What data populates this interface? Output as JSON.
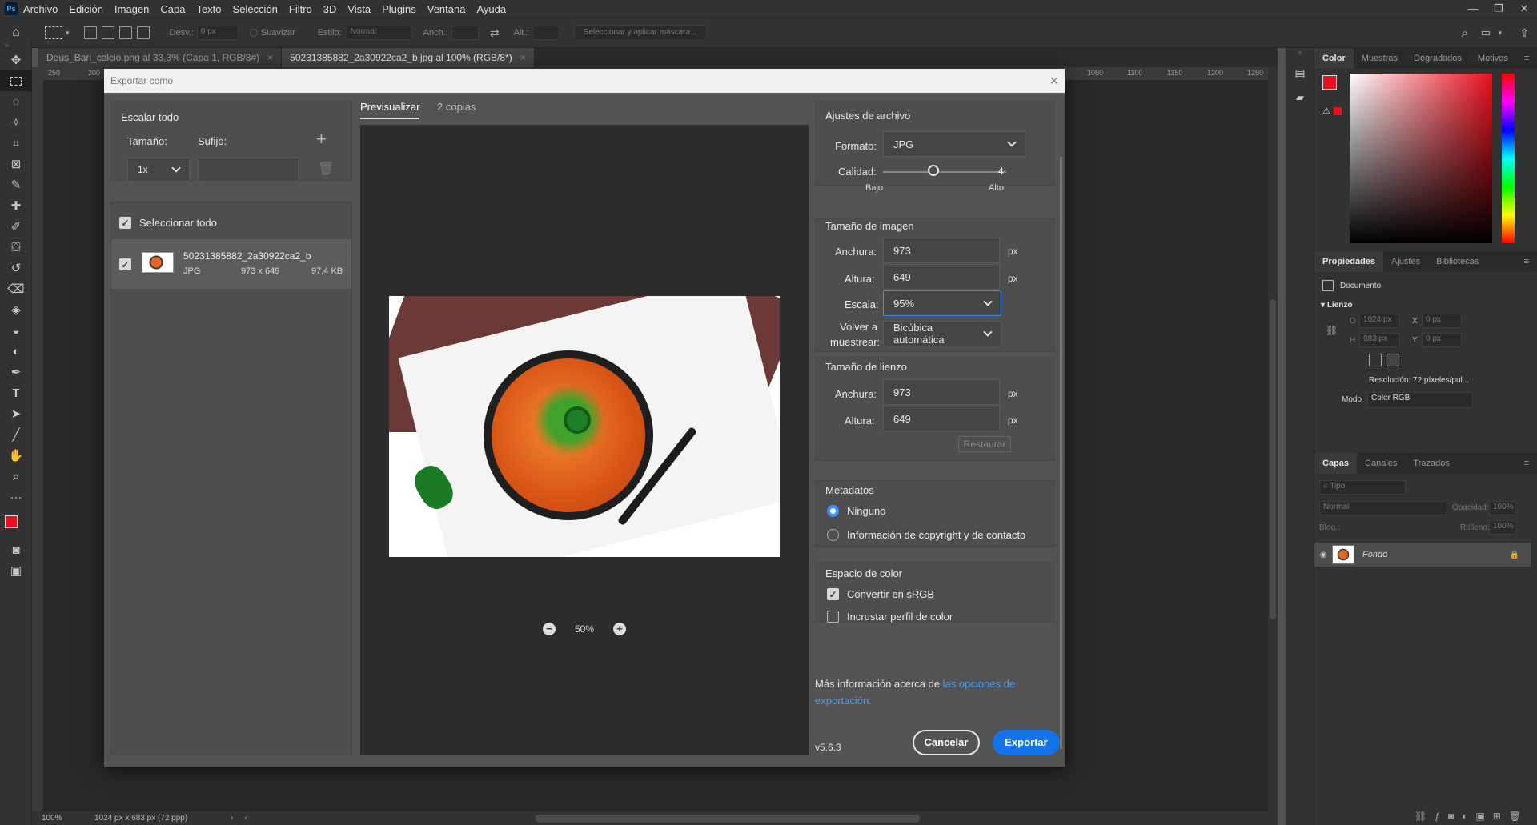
{
  "app": {
    "logo": "Ps",
    "menu": [
      "Archivo",
      "Edición",
      "Imagen",
      "Capa",
      "Texto",
      "Selección",
      "Filtro",
      "3D",
      "Vista",
      "Plugins",
      "Ventana",
      "Ayuda"
    ]
  },
  "options_bar": {
    "desv_label": "Desv.:",
    "desv_value": "0 px",
    "suavizar": "Suavizar",
    "estilo_label": "Estilo:",
    "estilo_value": "Normal",
    "anch_label": "Anch.:",
    "alt_label": "Alt.:",
    "mask_button": "Seleccionar y aplicar máscara..."
  },
  "tabs": [
    {
      "label": "Deus_Bari_calcio.png al 33,3% (Capa 1, RGB/8#)",
      "close": "×"
    },
    {
      "label": "50231385882_2a30922ca2_b.jpg al 100% (RGB/8*)",
      "close": "×"
    }
  ],
  "ruler": {
    "left_ticks": [
      "250",
      "200"
    ],
    "right_ticks": [
      "1050",
      "1100",
      "1150",
      "1200",
      "1250"
    ]
  },
  "statusbar": {
    "zoom": "100%",
    "info": "1024 px x 683 px (72 ppp)"
  },
  "dialog": {
    "title": "Exportar como",
    "left": {
      "scale_title": "Escalar todo",
      "size_label": "Tamaño:",
      "suffix_label": "Sufijo:",
      "size_value": "1x",
      "select_all": "Seleccionar todo",
      "file": {
        "name": "50231385882_2a30922ca2_b",
        "format": "JPG",
        "dims": "973 x 649",
        "size": "97,4 KB"
      }
    },
    "preview": {
      "tab_preview": "Previsualizar",
      "tab_copies": "2 copias",
      "zoom": "50%"
    },
    "file_settings": {
      "title": "Ajustes de archivo",
      "format_label": "Formato:",
      "format_value": "JPG",
      "quality_label": "Calidad:",
      "quality_value": "4",
      "quality_low": "Bajo",
      "quality_high": "Alto"
    },
    "image_size": {
      "title": "Tamaño de imagen",
      "width_label": "Anchura:",
      "width_value": "973",
      "height_label": "Altura:",
      "height_value": "649",
      "scale_label": "Escala:",
      "scale_value": "95%",
      "resample_label_1": "Volver a",
      "resample_label_2": "muestrear:",
      "resample_value": "Bicúbica automática",
      "unit": "px"
    },
    "canvas_size": {
      "title": "Tamaño de lienzo",
      "width_label": "Anchura:",
      "width_value": "973",
      "height_label": "Altura:",
      "height_value": "649",
      "unit": "px",
      "restore": "Restaurar"
    },
    "metadata": {
      "title": "Metadatos",
      "none": "Ninguno",
      "copyright": "Información de copyright y de contacto"
    },
    "color_space": {
      "title": "Espacio de color",
      "srgb": "Convertir en sRGB",
      "embed": "Incrustar perfil de color"
    },
    "more_info": "Más información acerca de",
    "more_info_link": "las opciones de exportación.",
    "version": "v5.6.3",
    "cancel": "Cancelar",
    "export": "Exportar"
  },
  "panels": {
    "color_tabs": [
      "Color",
      "Muestras",
      "Degradados",
      "Motivos"
    ],
    "props_tabs": [
      "Propiedades",
      "Ajustes",
      "Bibliotecas"
    ],
    "document_label": "Documento",
    "canvas_label": "Lienzo",
    "w_value": "1024 px",
    "h_value": "683 px",
    "x_value": "0 px",
    "y_value": "0 px",
    "w_label": "O",
    "h_label": "H",
    "x_label": "X",
    "y_label": "Y",
    "resolution": "Resolución: 72 píxeles/pul...",
    "mode_label": "Modo",
    "mode_value": "Color RGB",
    "layers_tabs": [
      "Capas",
      "Canales",
      "Trazados"
    ],
    "search_placeholder": "Tipo",
    "blend": "Normal",
    "opacity_label": "Opacidad:",
    "opacity_value": "100%",
    "lock_label": "Bloq.:",
    "fill_label": "Relleno:",
    "fill_value": "100%",
    "layer_name": "Fondo"
  },
  "colors": {
    "accent": "#1473e6",
    "foreground": "#e8101e",
    "hue_top": "#e8101e"
  }
}
